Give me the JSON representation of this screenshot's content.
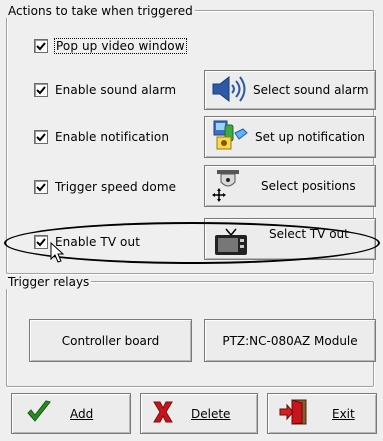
{
  "actions": {
    "title": "Actions to take when triggered",
    "items": [
      {
        "label": "Pop up video window",
        "checked": true
      },
      {
        "label": "Enable sound alarm",
        "checked": true,
        "button": "Select sound alarm",
        "icon": "speaker-icon"
      },
      {
        "label": "Enable notification",
        "checked": true,
        "button": "Set up notification",
        "icon": "notification-icon"
      },
      {
        "label": "Trigger speed dome",
        "checked": true,
        "button": "Select positions",
        "icon": "speed-dome-icon"
      },
      {
        "label": "Enable TV out",
        "checked": true,
        "button": "Select TV out",
        "icon": "tv-icon"
      }
    ]
  },
  "relays": {
    "title": "Trigger relays",
    "buttons": [
      "Controller board",
      "PTZ:NC-080AZ Module"
    ]
  },
  "footer": {
    "add": "Add",
    "delete": "Delete",
    "exit": "Exit"
  },
  "colors": {
    "background": "#efefef",
    "highlight_ellipse": "#000000",
    "check_green": "#2a8b1f",
    "delete_red": "#c8151b"
  }
}
